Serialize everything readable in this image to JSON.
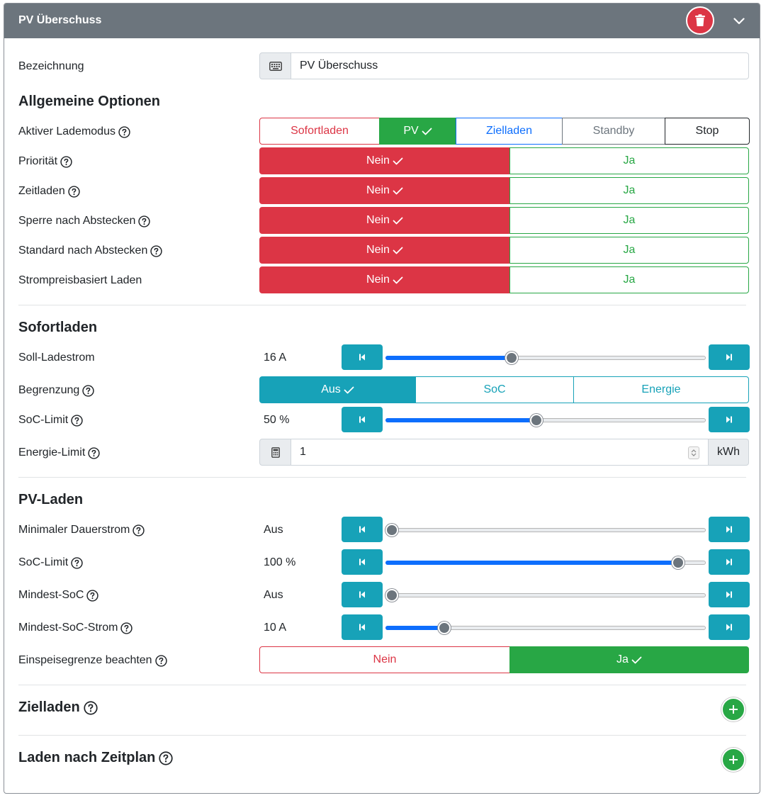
{
  "header": {
    "title": "PV Überschuss",
    "delete_icon": "trash-icon",
    "collapse_icon": "chevron-down-icon",
    "color": "#6c757d"
  },
  "name_field": {
    "label": "Bezeichnung",
    "value": "PV Überschuss",
    "icon": "keyboard-icon"
  },
  "general": {
    "title": "Allgemeine Optionen",
    "mode": {
      "label": "Aktiver Lademodus",
      "options": [
        "Sofortladen",
        "PV",
        "Zielladen",
        "Standby",
        "Stop"
      ],
      "selected": "PV"
    },
    "toggles": [
      {
        "label": "Priorität",
        "help": true,
        "no": "Nein",
        "yes": "Ja",
        "selected": "Nein"
      },
      {
        "label": "Zeitladen",
        "help": true,
        "no": "Nein",
        "yes": "Ja",
        "selected": "Nein"
      },
      {
        "label": "Sperre nach Abstecken",
        "help": true,
        "no": "Nein",
        "yes": "Ja",
        "selected": "Nein"
      },
      {
        "label": "Standard nach Abstecken",
        "help": true,
        "no": "Nein",
        "yes": "Ja",
        "selected": "Nein"
      },
      {
        "label": "Strompreisbasiert Laden",
        "help": false,
        "no": "Nein",
        "yes": "Ja",
        "selected": "Nein"
      }
    ]
  },
  "instant": {
    "title": "Sofortladen",
    "current": {
      "label": "Soll-Ladestrom",
      "value": "16 A",
      "fraction": 0.39
    },
    "limit": {
      "label": "Begrenzung",
      "options": [
        "Aus",
        "SoC",
        "Energie"
      ],
      "selected": "Aus"
    },
    "soc_limit": {
      "label": "SoC-Limit",
      "value": "50 %",
      "fraction": 0.47
    },
    "energy_limit": {
      "label": "Energie-Limit",
      "value": "1",
      "unit": "kWh",
      "icon": "calculator-icon"
    }
  },
  "pv": {
    "title": "PV-Laden",
    "sliders": [
      {
        "label": "Minimaler Dauerstrom",
        "value": "Aus",
        "fraction": 0.0
      },
      {
        "label": "SoC-Limit",
        "value": "100 %",
        "fraction": 0.93
      },
      {
        "label": "Mindest-SoC",
        "value": "Aus",
        "fraction": 0.0
      },
      {
        "label": "Mindest-SoC-Strom",
        "value": "10 A",
        "fraction": 0.17
      }
    ],
    "feed_in": {
      "label": "Einspeisegrenze beachten",
      "no": "Nein",
      "yes": "Ja",
      "selected": "Ja"
    }
  },
  "target": {
    "title": "Zielladen",
    "add_icon": "plus-icon"
  },
  "schedule": {
    "title": "Laden nach Zeitplan",
    "add_icon": "plus-icon"
  },
  "colors": {
    "danger": "#dc3545",
    "success": "#28a745",
    "info": "#17a2b8",
    "primary": "#0d6efd",
    "secondary": "#6c757d"
  }
}
